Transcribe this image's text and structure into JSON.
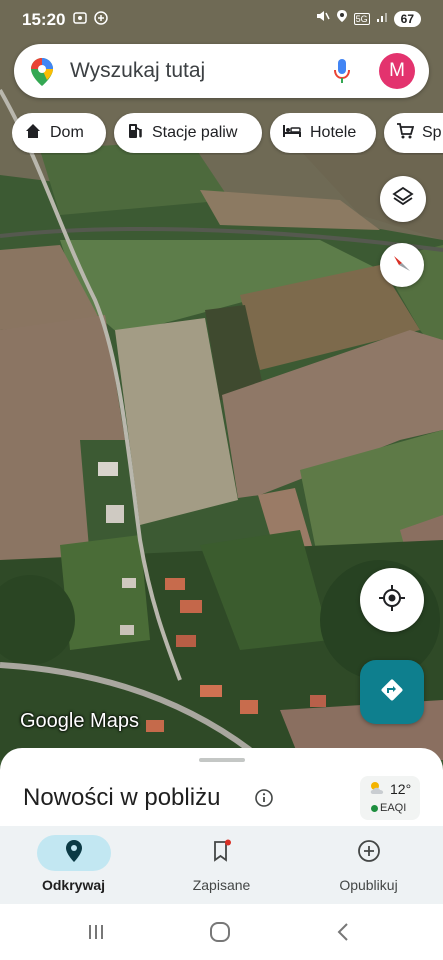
{
  "status": {
    "time": "15:20",
    "battery": "67",
    "network": "5G"
  },
  "search": {
    "placeholder": "Wyszukaj tutaj",
    "avatar_letter": "M"
  },
  "chips": [
    {
      "label": "Dom",
      "icon": "home-icon"
    },
    {
      "label": "Stacje paliw",
      "icon": "gas-station-icon"
    },
    {
      "label": "Hotele",
      "icon": "hotel-bed-icon"
    },
    {
      "label": "Sp",
      "icon": "shopping-cart-icon"
    }
  ],
  "map": {
    "watermark": "Google Maps",
    "type": "satellite"
  },
  "sheet": {
    "title": "Nowości w pobliżu",
    "weather": {
      "temp": "12°",
      "aqi_label": "EAQI"
    }
  },
  "nav": {
    "items": [
      {
        "label": "Odkrywaj",
        "icon": "location-pin-icon",
        "active": true
      },
      {
        "label": "Zapisane",
        "icon": "bookmark-icon",
        "active": false
      },
      {
        "label": "Opublikuj",
        "icon": "add-circle-icon",
        "active": false
      }
    ]
  },
  "colors": {
    "accent": "#0e7f8e",
    "avatar": "#e3336e",
    "active_pill": "#c2e7f2",
    "notification_dot": "#d93025"
  }
}
